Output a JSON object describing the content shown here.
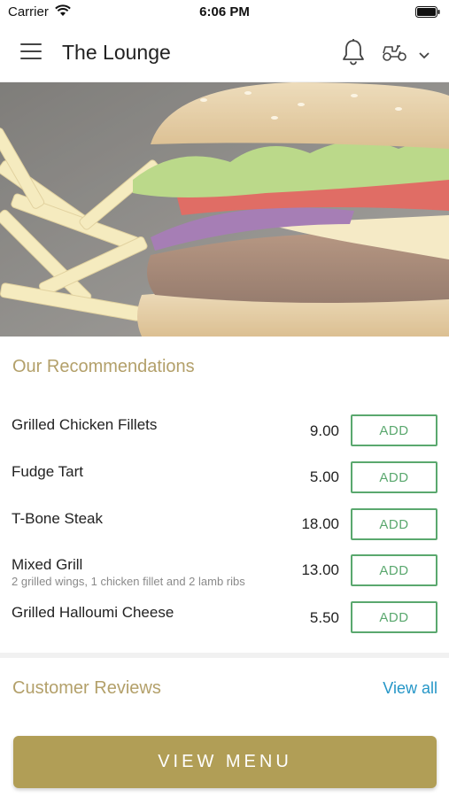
{
  "status_bar": {
    "carrier": "Carrier",
    "time": "6:06 PM"
  },
  "header": {
    "title": "The Lounge",
    "icons": [
      "menu-icon",
      "bell-icon",
      "scooter-icon",
      "chevron-down-icon"
    ]
  },
  "hero": {
    "icon": "burger-and-fries-photo"
  },
  "recommendations": {
    "title": "Our Recommendations",
    "add_label": "ADD",
    "items": [
      {
        "name": "Grilled Chicken Fillets",
        "description": "",
        "price": "9.00"
      },
      {
        "name": "Fudge Tart",
        "description": "",
        "price": "5.00"
      },
      {
        "name": "T-Bone Steak",
        "description": "",
        "price": "18.00"
      },
      {
        "name": "Mixed Grill",
        "description": "2 grilled wings, 1 chicken fillet and 2 lamb ribs",
        "price": "13.00"
      },
      {
        "name": "Grilled Halloumi Cheese",
        "description": "",
        "price": "5.50"
      }
    ]
  },
  "reviews": {
    "title": "Customer Reviews",
    "view_all": "View all"
  },
  "footer": {
    "view_menu": "VIEW MENU"
  },
  "colors": {
    "accent_gold": "#b19e56",
    "section_title": "#b3a06a",
    "add_green": "#5aa86e",
    "link_blue": "#2596c7"
  }
}
